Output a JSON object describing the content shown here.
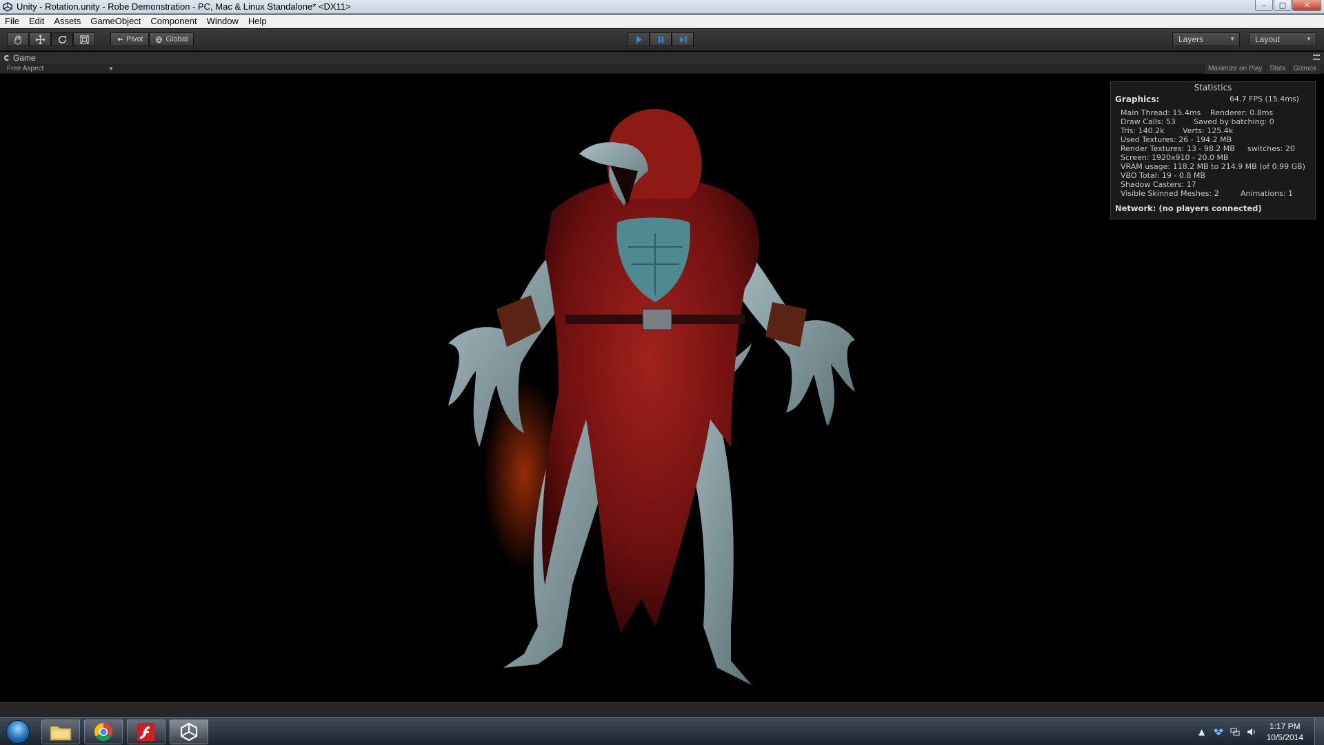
{
  "window": {
    "title": "Unity - Rotation.unity - Robe Demonstration - PC, Mac & Linux Standalone* <DX11>",
    "controls": {
      "minimize": "–",
      "maximize": "□",
      "close": "✕"
    }
  },
  "menu": [
    "File",
    "Edit",
    "Assets",
    "GameObject",
    "Component",
    "Window",
    "Help"
  ],
  "toolbar": {
    "tools": [
      "hand-tool",
      "move-tool",
      "rotate-tool",
      "scale-tool"
    ],
    "active_tool": "rotate-tool",
    "pivot_label": "Pivot",
    "global_label": "Global",
    "playback": [
      "play",
      "pause",
      "step"
    ],
    "layers_label": "Layers",
    "layout_label": "Layout"
  },
  "game_view": {
    "tab_label": "Game",
    "aspect_label": "Free Aspect",
    "toggles": [
      "Maximize on Play",
      "Stats",
      "Gizmos"
    ]
  },
  "stats": {
    "title": "Statistics",
    "graphics_label": "Graphics:",
    "fps": "64.7 FPS (15.4ms)",
    "main_thread": "Main Thread: 15.4ms",
    "renderer": "Renderer: 0.8ms",
    "draw_calls": "Draw Calls: 53",
    "saved_batching": "Saved by batching: 0",
    "tris": "Tris: 140.2k",
    "verts": "Verts: 125.4k",
    "used_textures": "Used Textures: 26 - 194.2 MB",
    "render_textures": "Render Textures: 13 - 98.2 MB",
    "switches": "switches: 20",
    "screen": "Screen: 1920x910 - 20.0 MB",
    "vram": "VRAM usage: 118.2 MB to 214.9 MB (of 0.99 GB)",
    "vbo": "VBO Total: 19 - 0.8 MB",
    "shadow_casters": "Shadow Casters: 17",
    "skinned_meshes": "Visible Skinned Meshes: 2",
    "animations": "Animations: 1",
    "network": "Network: (no players connected)"
  },
  "taskbar": {
    "apps": [
      "windows-explorer",
      "google-chrome",
      "adobe-flash",
      "unity"
    ],
    "active_app": "unity",
    "time": "1:17 PM",
    "date": "10/5/2014"
  },
  "colors": {
    "toolbar_bg": "#2a2a2a",
    "play_blue": "#2f86d6",
    "robe_red": "#8a1414",
    "skin_blue": "#8fa6ab"
  }
}
